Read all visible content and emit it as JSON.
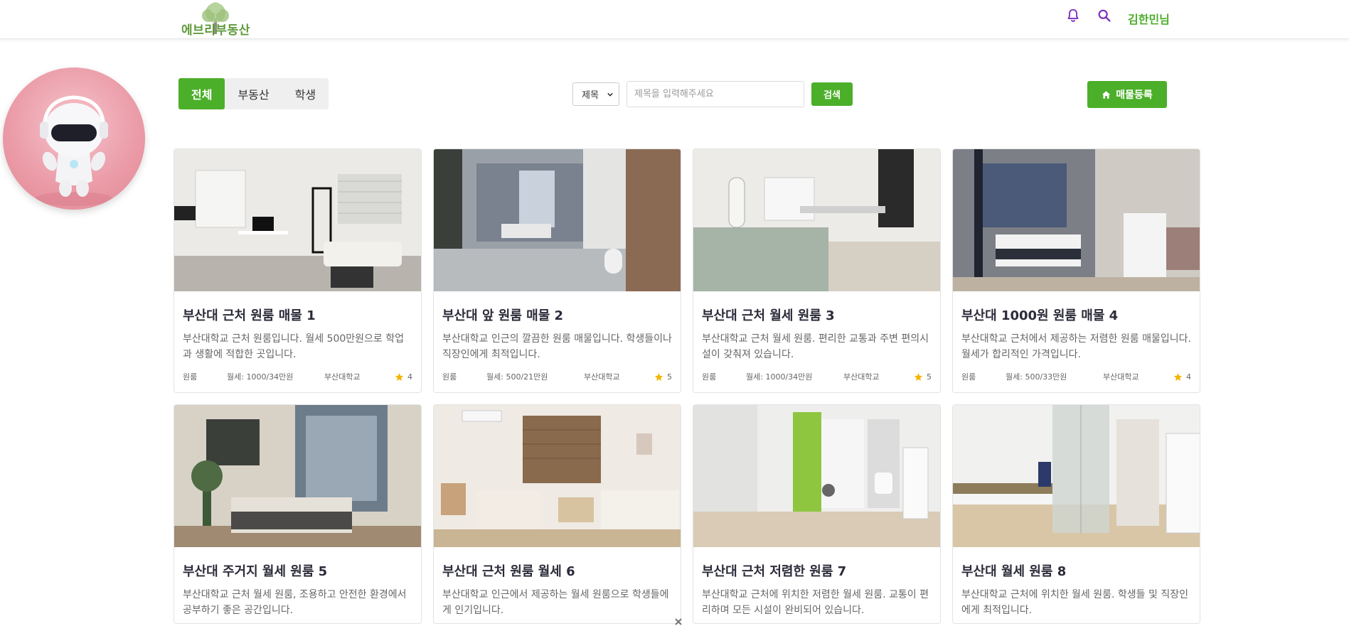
{
  "header": {
    "logo_text": "에브리부동산",
    "user_name": "김한민님",
    "icons": [
      "bell-icon",
      "search-icon"
    ]
  },
  "filters": {
    "tabs": [
      {
        "label": "전체",
        "active": true
      },
      {
        "label": "부동산",
        "active": false
      },
      {
        "label": "학생",
        "active": false
      }
    ]
  },
  "search": {
    "select_value": "제목",
    "placeholder": "제목을 입력해주세요",
    "button_label": "검색"
  },
  "register": {
    "label": "매물등록",
    "icon": "home-icon"
  },
  "colors": {
    "accent": "#4caf2a",
    "icon_purple": "#7b2fbf",
    "star": "#f5b400"
  },
  "listings": [
    {
      "title": "부산대 근처 원룸 매물 1",
      "desc": "부산대학교 근처 원룸입니다. 월세 500만원으로 학업과 생활에 적합한 곳입니다.",
      "type": "원룸",
      "price": "월세: 1000/34만원",
      "school": "부산대학교",
      "rating": "4"
    },
    {
      "title": "부산대 앞 원룸 매물 2",
      "desc": "부산대학교 인근의 깔끔한 원룸 매물입니다. 학생들이나 직장인에게 최적입니다.",
      "type": "원룸",
      "price": "월세: 500/21만원",
      "school": "부산대학교",
      "rating": "5"
    },
    {
      "title": "부산대 근처 월세 원룸 3",
      "desc": "부산대학교 근처 월세 원룸. 편리한 교통과 주변 편의시설이 갖춰져 있습니다.",
      "type": "원룸",
      "price": "월세: 1000/34만원",
      "school": "부산대학교",
      "rating": "5"
    },
    {
      "title": "부산대 1000원 원룸 매물 4",
      "desc": "부산대학교 근처에서 제공하는 저렴한 원룸 매물입니다. 월세가 합리적인 가격입니다.",
      "type": "원룸",
      "price": "월세: 500/33만원",
      "school": "부산대학교",
      "rating": "4"
    },
    {
      "title": "부산대 주거지 월세 원룸 5",
      "desc": "부산대학교 근처 월세 원룸, 조용하고 안전한 환경에서 공부하기 좋은 공간입니다.",
      "type": "",
      "price": "",
      "school": "",
      "rating": ""
    },
    {
      "title": "부산대 근처 원룸 월세 6",
      "desc": "부산대학교 인근에서 제공하는 월세 원룸으로 학생들에게 인기입니다.",
      "type": "",
      "price": "",
      "school": "",
      "rating": ""
    },
    {
      "title": "부산대 근처 저렴한 원룸 7",
      "desc": "부산대학교 근처에 위치한 저렴한 월세 원룸. 교통이 편리하며 모든 시설이 완비되어 있습니다.",
      "type": "",
      "price": "",
      "school": "",
      "rating": ""
    },
    {
      "title": "부산대 월세 원룸 8",
      "desc": "부산대학교 근처에 위치한 월세 원룸. 학생들 및 직장인에게 최적입니다.",
      "type": "",
      "price": "",
      "school": "",
      "rating": ""
    }
  ]
}
